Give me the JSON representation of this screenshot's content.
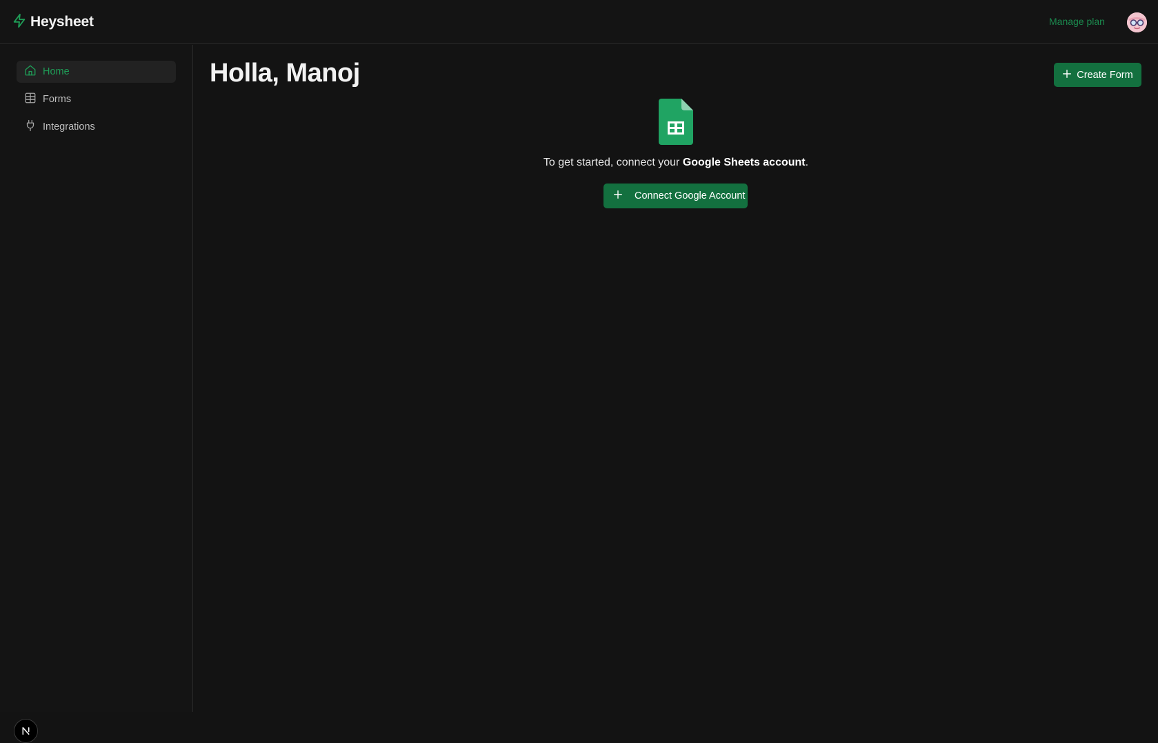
{
  "app": {
    "name": "Heysheet",
    "logo_icon": "bolt-icon",
    "accent_color": "#13703f"
  },
  "header": {
    "manage_plan_label": "Manage plan",
    "avatar_icon": "avatar-glasses"
  },
  "sidebar": {
    "items": [
      {
        "label": "Home",
        "icon": "home-icon",
        "active": true
      },
      {
        "label": "Forms",
        "icon": "table-grid-icon",
        "active": false
      },
      {
        "label": "Integrations",
        "icon": "plug-icon",
        "active": false
      }
    ],
    "footer_badge": "N"
  },
  "main": {
    "title": "Holla, Manoj",
    "create_form_label": "Create Form",
    "empty_state": {
      "icon": "google-sheets-icon",
      "text_prefix": "To get started, connect your ",
      "text_bold": "Google Sheets account",
      "text_suffix": ".",
      "connect_label": "Connect Google Account"
    }
  }
}
